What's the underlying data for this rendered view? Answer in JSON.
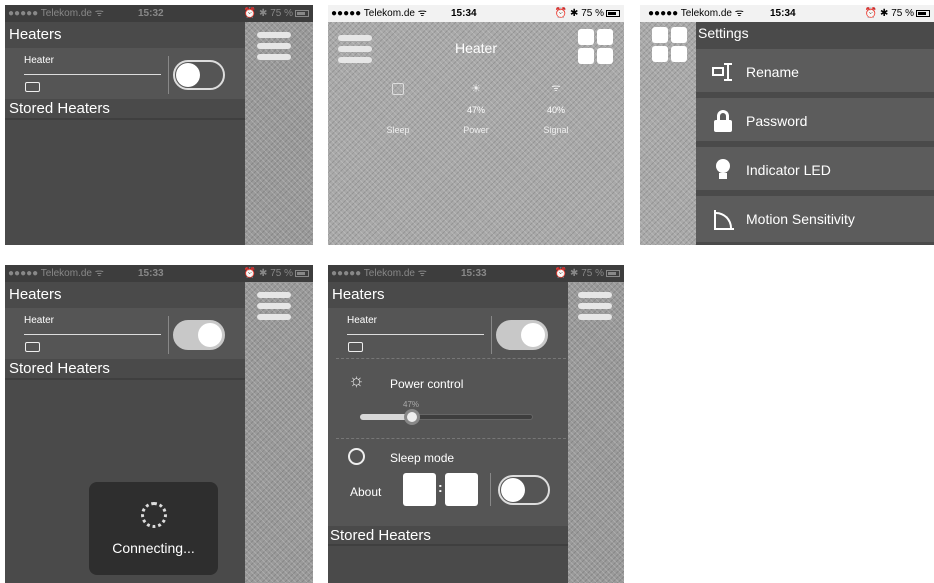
{
  "colors": {
    "panel_dark": "#4a4a4a",
    "band": "#555555",
    "toggle_on": "#c8c8c8",
    "overlay": "#2e2e2e"
  },
  "status": {
    "s1": {
      "carrier": "●●●●● Telekom.de ᯤ",
      "time": "15:32",
      "right": "⏰ ✱ 75 %"
    },
    "s2": {
      "carrier": "●●●●● Telekom.de ᯤ",
      "time": "15:34",
      "right": "⏰ ✱ 75 %"
    },
    "s3": {
      "carrier": "●●●●● Telekom.de ᯤ",
      "time": "15:34",
      "right": "⏰ ✱ 75 %"
    },
    "s4": {
      "carrier": "●●●●● Telekom.de ᯤ",
      "time": "15:33",
      "right": "⏰ ✱ 75 %"
    },
    "s5": {
      "carrier": "●●●●● Telekom.de ᯤ",
      "time": "15:33",
      "right": "⏰ ✱ 75 %"
    }
  },
  "screen1": {
    "section": "Heaters",
    "device": "Heater",
    "stored": "Stored Heaters",
    "toggle_on": false
  },
  "screen2": {
    "title": "Heater",
    "stats": [
      {
        "icon": "clock-icon",
        "value": "",
        "label": "Sleep"
      },
      {
        "icon": "sun-icon",
        "value": "47%",
        "label": "Power"
      },
      {
        "icon": "wifi-icon",
        "value": "40%",
        "label": "Signal"
      }
    ]
  },
  "screen3": {
    "title": "Settings",
    "items": [
      {
        "icon": "rename-icon",
        "label": "Rename"
      },
      {
        "icon": "lock-icon",
        "label": "Password"
      },
      {
        "icon": "bulb-icon",
        "label": "Indicator LED"
      },
      {
        "icon": "motion-icon",
        "label": "Motion Sensitivity"
      }
    ]
  },
  "screen4": {
    "section": "Heaters",
    "device": "Heater",
    "stored": "Stored Heaters",
    "connecting": "Connecting...",
    "toggle_on": true
  },
  "screen5": {
    "section": "Heaters",
    "device": "Heater",
    "power_label": "Power control",
    "power_value": "47%",
    "power_fraction": 0.3,
    "sleep_label": "Sleep mode",
    "about_label": "About",
    "stored": "Stored Heaters",
    "sleep_toggle_on": false,
    "toggle_on": true
  }
}
